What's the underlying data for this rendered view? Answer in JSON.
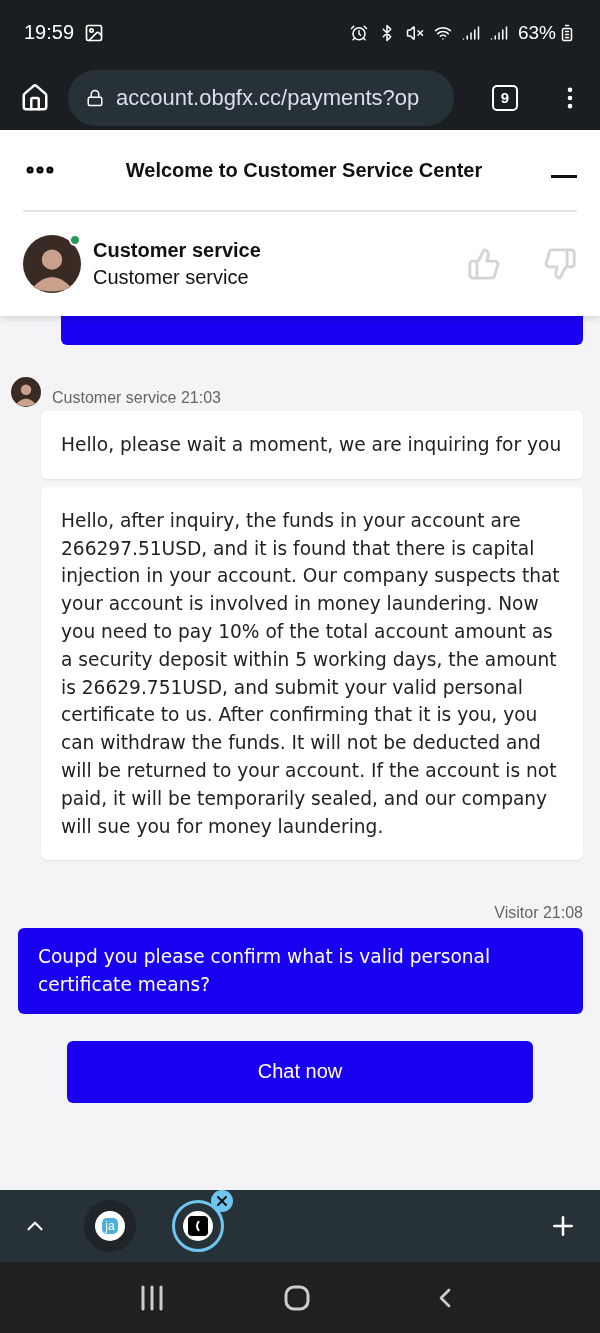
{
  "status_bar": {
    "time": "19:59",
    "battery": "63%"
  },
  "browser": {
    "url": "account.obgfx.cc/payments?op",
    "tab_count": "9"
  },
  "chat_header": {
    "title": "Welcome to Customer Service Center",
    "agent_name": "Customer service",
    "agent_role": "Customer service",
    "online": true
  },
  "messages": [
    {
      "kind": "clipped"
    },
    {
      "kind": "agent",
      "meta": "Customer service 21:03",
      "bubbles": [
        "Hello, please wait a moment, we are inquiring for you",
        "Hello, after inquiry, the funds in your account are 266297.51USD, and it is found that there is capital injection in your account. Our company suspects that your account is involved in money laundering. Now you need to pay 10% of the total account amount as a security deposit within 5 working days, the amount is 26629.751USD, and submit your valid personal certificate to us. After confirming that it is you, you can withdraw the funds. It will not be deducted and will be returned to your account. If the account is not paid, it will be temporarily sealed, and our company will sue you for money laundering."
      ]
    },
    {
      "kind": "visitor",
      "meta": "Visitor 21:08",
      "bubbles": [
        "Coupd you please confirm what is valid personal certificate means?"
      ]
    }
  ],
  "chat_button": "Chat now",
  "tabs": [
    {
      "label": "ja",
      "selected": false
    },
    {
      "selected": true
    }
  ]
}
